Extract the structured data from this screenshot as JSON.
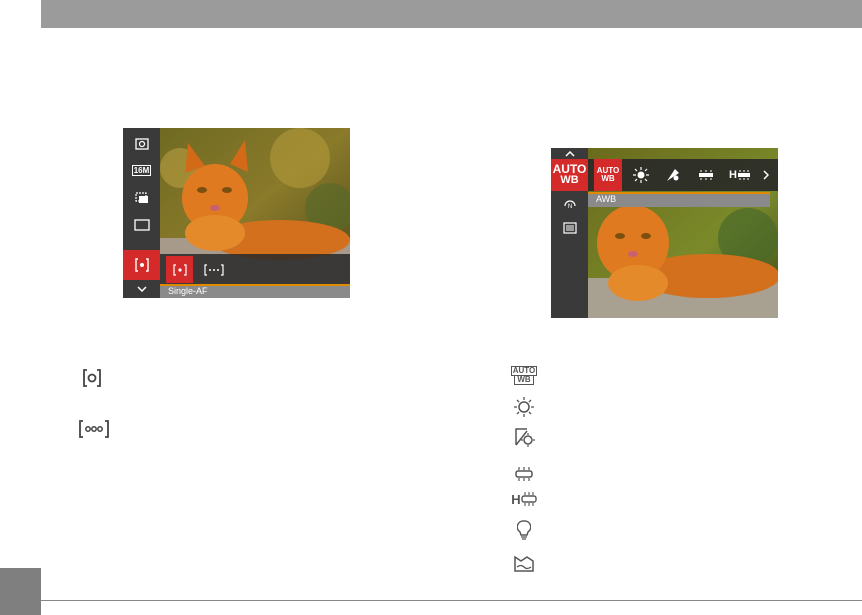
{
  "screen_af": {
    "sidebar_icons": [
      "metering-icon",
      "image-size-16m-icon",
      "continuous-shot-icon",
      "display-frame-icon",
      "af-mode-icon",
      "chevron-down-icon"
    ],
    "sidebar_label_16m": "16M",
    "options": [
      "single-af-icon",
      "multi-af-icon"
    ],
    "selected_label": "Single-AF"
  },
  "screen_wb": {
    "sidebar_main": "AUTO WB",
    "sidebar_main_line1": "AUTO",
    "sidebar_main_line2": "WB",
    "options": [
      {
        "icon": "auto-wb-icon",
        "line1": "AUTO",
        "line2": "WB"
      },
      {
        "icon": "daylight-icon"
      },
      {
        "icon": "shade-icon"
      },
      {
        "icon": "fluorescent-icon"
      },
      {
        "icon": "fluorescent-h-icon",
        "text": "H"
      }
    ],
    "selected_label": "AWB"
  },
  "legend_af": [
    "single-af-icon",
    "multi-af-icon"
  ],
  "legend_wb": [
    {
      "icon": "auto-wb-icon",
      "line1": "AUTO",
      "line2": "WB"
    },
    {
      "icon": "daylight-icon"
    },
    {
      "icon": "shade-icon"
    },
    {
      "icon": "fluorescent-icon"
    },
    {
      "icon": "fluorescent-h-icon",
      "text": "H"
    },
    {
      "icon": "incandescent-icon"
    },
    {
      "icon": "underwater-icon"
    }
  ],
  "colors": {
    "header_bar": "#9b9b9b",
    "accent_red": "#d42a2a",
    "label_bar": "#8a8a8a",
    "highlight_line": "#e08a00",
    "page_tab": "#7f7f7f"
  }
}
